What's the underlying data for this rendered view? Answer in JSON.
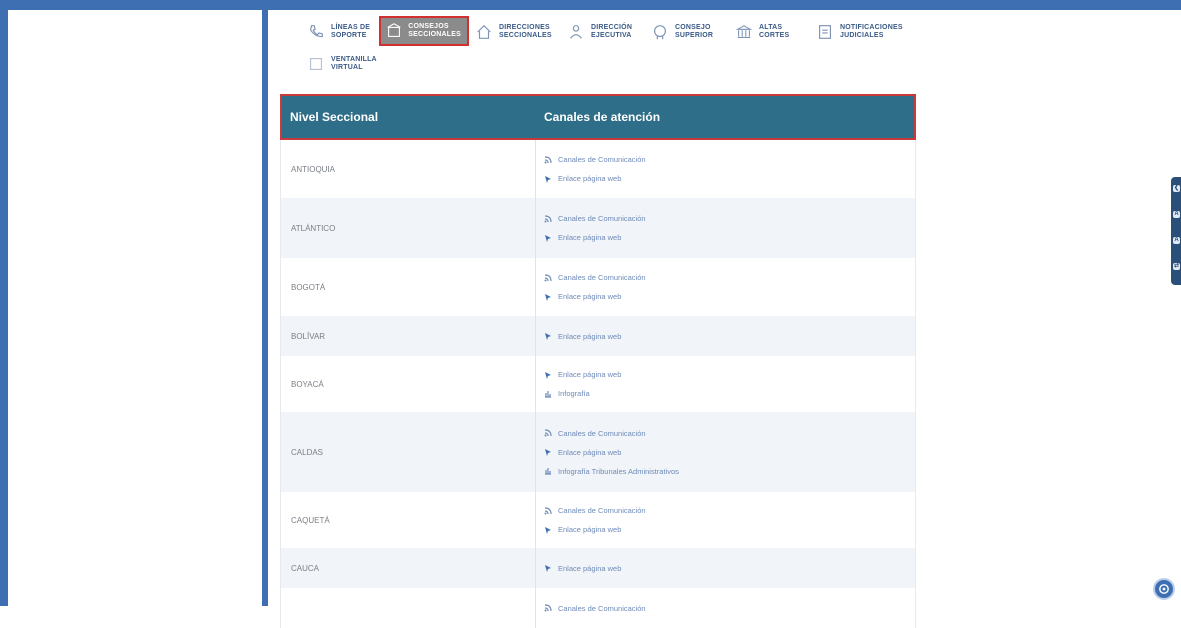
{
  "nav": {
    "items": [
      {
        "label": "LÍNEAS DE\nSOPORTE",
        "icon": "phone-icon"
      },
      {
        "label": "CONSEJOS\nSECCIONALES",
        "icon": "building-icon",
        "active": true
      },
      {
        "label": "DIRECCIONES\nSECCIONALES",
        "icon": "house-icon"
      },
      {
        "label": "DIRECCIÓN\nEJECUTIVA",
        "icon": "user-icon"
      },
      {
        "label": "CONSEJO\nSUPERIOR",
        "icon": "seal-icon"
      },
      {
        "label": "ALTAS\nCORTES",
        "icon": "courthouse-icon"
      },
      {
        "label": "NOTIFICACIONES\nJUDICIALES",
        "icon": "document-icon"
      },
      {
        "label": "VENTANILLA\nVIRTUAL",
        "icon": "window-icon"
      }
    ]
  },
  "table": {
    "headers": [
      "Nivel Seccional",
      "Canales de atención"
    ],
    "rows": [
      {
        "name": "ANTIOQUIA",
        "links": [
          "Canales de Comunicación",
          "Enlace página web"
        ]
      },
      {
        "name": "ATLÁNTICO",
        "links": [
          "Canales de Comunicación",
          "Enlace página web"
        ]
      },
      {
        "name": "BOGOTÁ",
        "links": [
          "Canales de Comunicación",
          "Enlace página web"
        ]
      },
      {
        "name": "BOLÍVAR",
        "links": [
          "Enlace página web"
        ]
      },
      {
        "name": "BOYACÁ",
        "links": [
          "Enlace página web",
          "Infografía"
        ]
      },
      {
        "name": "CALDAS",
        "links": [
          "Canales de Comunicación",
          "Enlace página web",
          "Infografía Tribunales Administrativos"
        ]
      },
      {
        "name": "CAQUETÁ",
        "links": [
          "Canales de Comunicación",
          "Enlace página web"
        ]
      },
      {
        "name": "CAUCA",
        "links": [
          "Enlace página web"
        ]
      },
      {
        "name": "",
        "links": [
          "Canales de Comunicación"
        ]
      }
    ]
  },
  "side_tools": [
    "❮",
    "A",
    "A",
    "⇄"
  ],
  "colors": {
    "frame": "#3e6fb3",
    "header": "#2f6e88",
    "highlight": "#d23030"
  }
}
